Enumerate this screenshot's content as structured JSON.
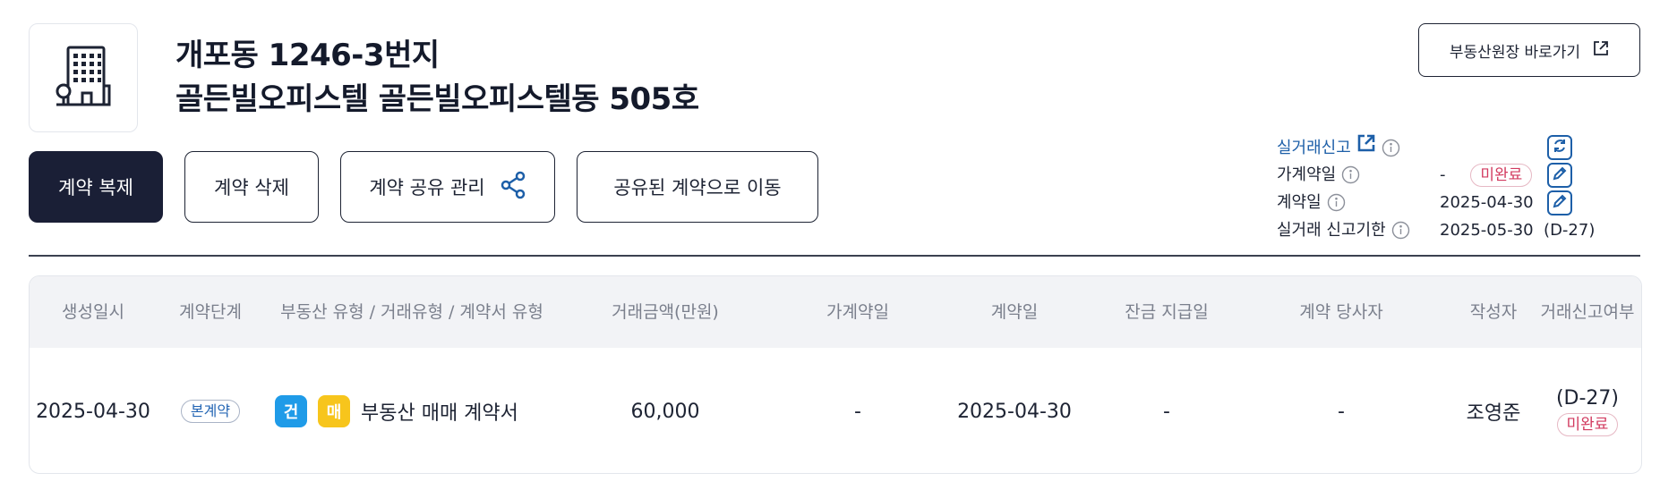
{
  "header": {
    "address_line1": "개포동 1246-3번지",
    "address_line2": "골든빌오피스텔 골든빌오피스텔동 505호",
    "ledger_link_label": "부동산원장 바로가기"
  },
  "actions": {
    "duplicate": "계약 복제",
    "delete": "계약 삭제",
    "share_manage": "계약 공유 관리",
    "go_shared": "공유된 계약으로 이동"
  },
  "info": {
    "real_report_label": "실거래신고",
    "real_report_status": "미완료",
    "provisional_label": "가계약일",
    "provisional_value": "-",
    "contract_label": "계약일",
    "contract_value": "2025-04-30",
    "deadline_label": "실거래 신고기한",
    "deadline_value": "2025-05-30  (D-27)"
  },
  "table": {
    "headers": {
      "created": "생성일시",
      "stage": "계약단계",
      "types": "부동산 유형 / 거래유형 / 계약서 유형",
      "amount": "거래금액(만원)",
      "provisional": "가계약일",
      "contract": "계약일",
      "balance": "잔금 지급일",
      "parties": "계약 당사자",
      "author": "작성자",
      "report": "거래신고여부"
    },
    "row": {
      "created": "2025-04-30",
      "stage": "본계약",
      "property_chip": "건",
      "deal_chip": "매",
      "doc_type": "부동산 매매 계약서",
      "amount": "60,000",
      "provisional": "-",
      "contract": "2025-04-30",
      "balance": "-",
      "parties": "-",
      "author": "조영준",
      "report_dday": "(D-27)",
      "report_status": "미완료"
    }
  },
  "colors": {
    "primary_dark": "#1a1f36",
    "link_blue": "#1d5fa8",
    "status_pink": "#d23a5f",
    "chip_blue": "#1f9be8",
    "chip_yellow": "#f7c51c"
  }
}
